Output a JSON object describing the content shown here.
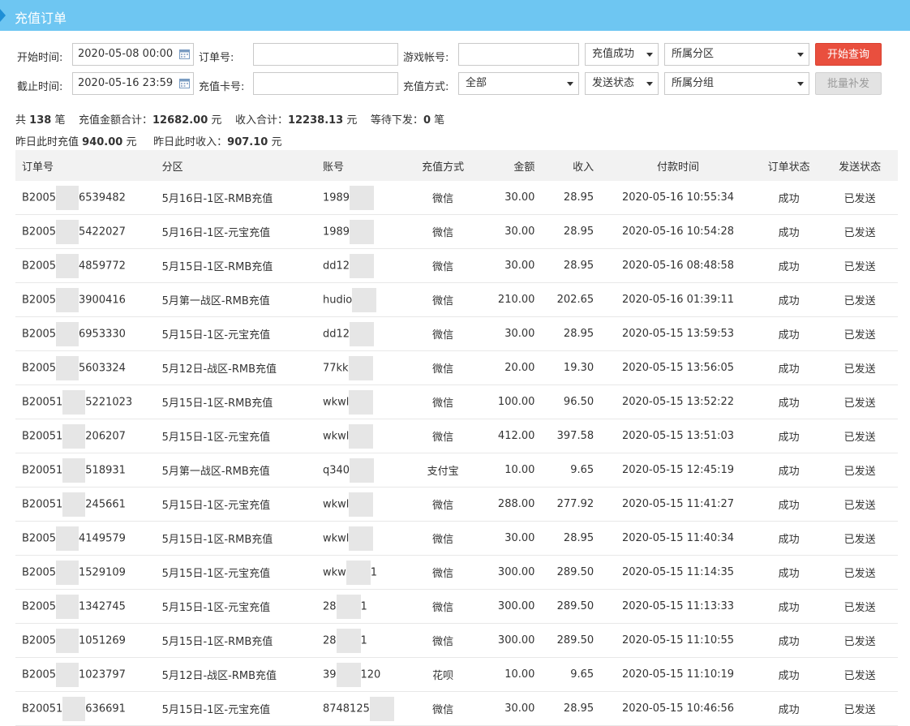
{
  "header": {
    "title": "充值订单"
  },
  "filters": {
    "start_label": "开始时间:",
    "start_value": "2020-05-08 00:00",
    "end_label": "截止时间:",
    "end_value": "2020-05-16 23:59",
    "order_label": "订单号:",
    "order_value": "",
    "card_label": "充值卡号:",
    "card_value": "",
    "account_label": "游戏帐号:",
    "account_value": "",
    "method_label": "充值方式:",
    "method_value": "全部",
    "status_value": "充值成功",
    "send_status_value": "发送状态",
    "zone_value": "所属分区",
    "group_value": "所属分组",
    "query_button": "开始查询",
    "batch_button": "批量补发"
  },
  "summary": {
    "total_prefix": "共",
    "total_count": "138",
    "total_unit": "笔",
    "amount_label": "充值金额合计：",
    "amount_value": "12682.00",
    "amount_unit": "元",
    "income_label": "收入合计：",
    "income_value": "12238.13",
    "income_unit": "元",
    "pending_label": "等待下发：",
    "pending_value": "0",
    "pending_unit": "笔",
    "yest_recharge_label": "昨日此时充值",
    "yest_recharge_value": "940.00",
    "yest_recharge_unit": "元",
    "yest_income_label": "昨日此时收入：",
    "yest_income_value": "907.10",
    "yest_income_unit": "元"
  },
  "table": {
    "columns": [
      "订单号",
      "分区",
      "账号",
      "充值方式",
      "金额",
      "收入",
      "付款时间",
      "订单状态",
      "发送状态"
    ],
    "rows": [
      {
        "id_pre": "B2005",
        "id_suf": "6539482",
        "zone": "5月16日-1区-RMB充值",
        "acc": "1989",
        "acc_suf": "",
        "method": "微信",
        "amount": "30.00",
        "income": "28.95",
        "time": "2020-05-16 10:55:34",
        "status": "成功",
        "sent": "已发送"
      },
      {
        "id_pre": "B2005",
        "id_suf": "5422027",
        "zone": "5月16日-1区-元宝充值",
        "acc": "1989",
        "acc_suf": "",
        "method": "微信",
        "amount": "30.00",
        "income": "28.95",
        "time": "2020-05-16 10:54:28",
        "status": "成功",
        "sent": "已发送"
      },
      {
        "id_pre": "B2005",
        "id_suf": "4859772",
        "zone": "5月15日-1区-RMB充值",
        "acc": "dd12",
        "acc_suf": "",
        "method": "微信",
        "amount": "30.00",
        "income": "28.95",
        "time": "2020-05-16 08:48:58",
        "status": "成功",
        "sent": "已发送"
      },
      {
        "id_pre": "B2005",
        "id_suf": "3900416",
        "zone": "5月第一战区-RMB充值",
        "acc": "hudio",
        "acc_suf": "",
        "method": "微信",
        "amount": "210.00",
        "income": "202.65",
        "time": "2020-05-16 01:39:11",
        "status": "成功",
        "sent": "已发送"
      },
      {
        "id_pre": "B2005",
        "id_suf": "6953330",
        "zone": "5月15日-1区-元宝充值",
        "acc": "dd12",
        "acc_suf": "",
        "method": "微信",
        "amount": "30.00",
        "income": "28.95",
        "time": "2020-05-15 13:59:53",
        "status": "成功",
        "sent": "已发送"
      },
      {
        "id_pre": "B2005",
        "id_suf": "5603324",
        "zone": "5月12日-战区-RMB充值",
        "acc": "77kk",
        "acc_suf": "",
        "method": "微信",
        "amount": "20.00",
        "income": "19.30",
        "time": "2020-05-15 13:56:05",
        "status": "成功",
        "sent": "已发送"
      },
      {
        "id_pre": "B20051",
        "id_suf": "5221023",
        "zone": "5月15日-1区-RMB充值",
        "acc": "wkwl",
        "acc_suf": "",
        "method": "微信",
        "amount": "100.00",
        "income": "96.50",
        "time": "2020-05-15 13:52:22",
        "status": "成功",
        "sent": "已发送"
      },
      {
        "id_pre": "B20051",
        "id_suf": "206207",
        "zone": "5月15日-1区-元宝充值",
        "acc": "wkwl",
        "acc_suf": "",
        "method": "微信",
        "amount": "412.00",
        "income": "397.58",
        "time": "2020-05-15 13:51:03",
        "status": "成功",
        "sent": "已发送"
      },
      {
        "id_pre": "B20051",
        "id_suf": "518931",
        "zone": "5月第一战区-RMB充值",
        "acc": "q340",
        "acc_suf": "",
        "method": "支付宝",
        "amount": "10.00",
        "income": "9.65",
        "time": "2020-05-15 12:45:19",
        "status": "成功",
        "sent": "已发送"
      },
      {
        "id_pre": "B20051",
        "id_suf": "245661",
        "zone": "5月15日-1区-元宝充值",
        "acc": "wkwl",
        "acc_suf": "",
        "method": "微信",
        "amount": "288.00",
        "income": "277.92",
        "time": "2020-05-15 11:41:27",
        "status": "成功",
        "sent": "已发送"
      },
      {
        "id_pre": "B2005",
        "id_suf": "4149579",
        "zone": "5月15日-1区-RMB充值",
        "acc": "wkwl",
        "acc_suf": "",
        "method": "微信",
        "amount": "30.00",
        "income": "28.95",
        "time": "2020-05-15 11:40:34",
        "status": "成功",
        "sent": "已发送"
      },
      {
        "id_pre": "B2005",
        "id_suf": "1529109",
        "zone": "5月15日-1区-元宝充值",
        "acc": "wkw",
        "acc_suf": "1",
        "method": "微信",
        "amount": "300.00",
        "income": "289.50",
        "time": "2020-05-15 11:14:35",
        "status": "成功",
        "sent": "已发送"
      },
      {
        "id_pre": "B2005",
        "id_suf": "1342745",
        "zone": "5月15日-1区-元宝充值",
        "acc": "28",
        "acc_suf": "1",
        "method": "微信",
        "amount": "300.00",
        "income": "289.50",
        "time": "2020-05-15 11:13:33",
        "status": "成功",
        "sent": "已发送"
      },
      {
        "id_pre": "B2005",
        "id_suf": "1051269",
        "zone": "5月15日-1区-RMB充值",
        "acc": "28",
        "acc_suf": "1",
        "method": "微信",
        "amount": "300.00",
        "income": "289.50",
        "time": "2020-05-15 11:10:55",
        "status": "成功",
        "sent": "已发送"
      },
      {
        "id_pre": "B2005",
        "id_suf": "1023797",
        "zone": "5月12日-战区-RMB充值",
        "acc": "39",
        "acc_suf": "120",
        "method": "花呗",
        "amount": "10.00",
        "income": "9.65",
        "time": "2020-05-15 11:10:19",
        "status": "成功",
        "sent": "已发送"
      },
      {
        "id_pre": "B20051",
        "id_suf": "636691",
        "zone": "5月15日-1区-元宝充值",
        "acc": "8748125",
        "acc_suf": "",
        "method": "微信",
        "amount": "30.00",
        "income": "28.95",
        "time": "2020-05-15 10:46:56",
        "status": "成功",
        "sent": "已发送"
      }
    ]
  }
}
